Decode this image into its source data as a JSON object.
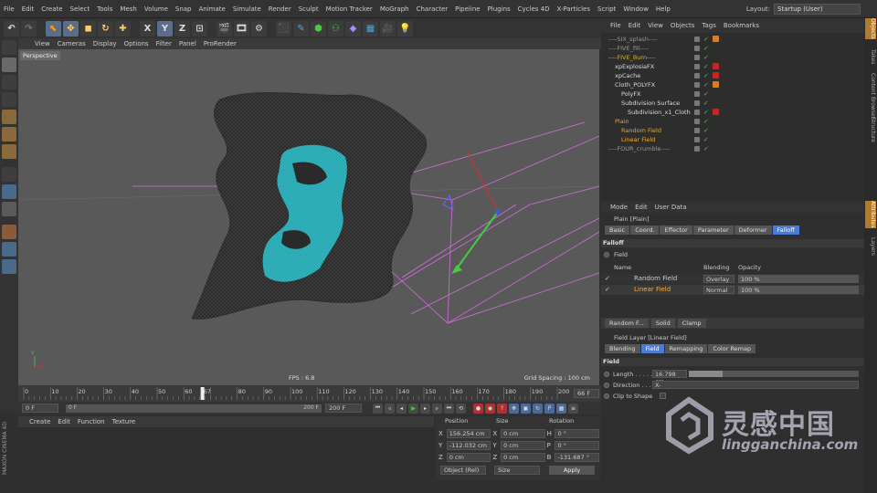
{
  "menubar": {
    "items": [
      "File",
      "Edit",
      "Create",
      "Select",
      "Tools",
      "Mesh",
      "Volume",
      "Snap",
      "Animate",
      "Simulate",
      "Render",
      "Sculpt",
      "Motion Tracker",
      "MoGraph",
      "Character",
      "Pipeline",
      "Plugins",
      "Cycles 4D",
      "X-Particles",
      "Script",
      "Window",
      "Help"
    ],
    "layout_label": "Layout:",
    "layout_value": "Startup (User)"
  },
  "toolbar": {
    "axis_x": "X",
    "axis_y": "Y",
    "axis_z": "Z"
  },
  "viewport": {
    "menu": [
      "View",
      "Cameras",
      "Display",
      "Options",
      "Filter",
      "Panel",
      "ProRender"
    ],
    "label": "Perspective",
    "fps": "FPS : 6.8",
    "grid_spacing": "Grid Spacing : 100 cm",
    "axis_y": "Y",
    "axis_z": "Z",
    "axis_x": "X"
  },
  "timeline": {
    "ticks": [
      "0",
      "10",
      "20",
      "30",
      "40",
      "50",
      "60",
      "67",
      "80",
      "90",
      "100",
      "110",
      "120",
      "130",
      "140",
      "150",
      "160",
      "170",
      "180",
      "190",
      "200"
    ],
    "current_frame": "66 F",
    "current": 67,
    "end": 200
  },
  "transport": {
    "start": "0 F",
    "range_start": "0 F",
    "range_end": "200 F",
    "end": "200 F"
  },
  "material": {
    "menu": [
      "Create",
      "Edit",
      "Function",
      "Texture"
    ],
    "brand": "MAXON CINEMA 4D"
  },
  "coord": {
    "headers": [
      "Position",
      "Size",
      "Rotation"
    ],
    "rows": [
      {
        "pl": "X",
        "p": "156.254 cm",
        "sl": "X",
        "s": "0 cm",
        "rl": "H",
        "r": "0 °"
      },
      {
        "pl": "Y",
        "p": "-112.032 cm",
        "sl": "Y",
        "s": "0 cm",
        "rl": "P",
        "r": "0 °"
      },
      {
        "pl": "Z",
        "p": "0 cm",
        "sl": "Z",
        "s": "0 cm",
        "rl": "B",
        "r": "-131.687 °"
      }
    ],
    "mode": "Object (Rel)",
    "size_mode": "Size",
    "apply": "Apply"
  },
  "objmgr": {
    "menu": [
      "File",
      "Edit",
      "View",
      "Objects",
      "Tags",
      "Bookmarks"
    ],
    "items": [
      {
        "name": "----SIX_splash----",
        "indent": 0,
        "color": "#999"
      },
      {
        "name": "----FIVE_fill----",
        "indent": 0,
        "color": "#999"
      },
      {
        "name": "----FIVE_Burn----",
        "indent": 0,
        "color": "#c9b24a"
      },
      {
        "name": "xpExplosiaFX",
        "indent": 1,
        "color": "#ddd"
      },
      {
        "name": "xpCache",
        "indent": 1,
        "color": "#ddd"
      },
      {
        "name": "Cloth_POLYFX",
        "indent": 1,
        "color": "#ddd"
      },
      {
        "name": "PolyFX",
        "indent": 2,
        "color": "#ddd"
      },
      {
        "name": "Subdivision Surface",
        "indent": 2,
        "color": "#ddd"
      },
      {
        "name": "Subdivision_x1_Cloth",
        "indent": 3,
        "color": "#ddd"
      },
      {
        "name": "Plain",
        "indent": 1,
        "color": "#e8a33a"
      },
      {
        "name": "Random Field",
        "indent": 2,
        "color": "#e8a33a"
      },
      {
        "name": "Linear Field",
        "indent": 2,
        "color": "#f0b040"
      },
      {
        "name": "----FOUR_crumble----",
        "indent": 0,
        "color": "#999"
      }
    ]
  },
  "attr": {
    "menu": [
      "Mode",
      "Edit",
      "User Data"
    ],
    "title": "Plain [Plain]",
    "tabs": [
      "Basic",
      "Coord.",
      "Effector",
      "Parameter",
      "Deformer",
      "Falloff"
    ],
    "active_tab": "Falloff",
    "falloff_head": "Falloff",
    "field_label": "Field",
    "col_name": "Name",
    "col_blend": "Blending",
    "col_opacity": "Opacity",
    "layers": [
      {
        "name": "Random Field",
        "blend": "Overlay",
        "opacity": "100 %"
      },
      {
        "name": "Linear Field",
        "blend": "Normal",
        "opacity": "100 %"
      }
    ],
    "layer_buttons": [
      "Random F...",
      "Solid",
      "Clamp"
    ],
    "layer_title": "Field Layer [Linear Field]",
    "layer_tabs": [
      "Blending",
      "Field",
      "Remapping",
      "Color Remap"
    ],
    "layer_active": "Field",
    "field_head": "Field",
    "length_label": "Length . . . . . .",
    "length_value": "16.798 cm",
    "length_fraction": 0.2,
    "direction_label": "Direction . . . .",
    "direction_value": "X-",
    "clip_label": "Clip to Shape"
  },
  "sidetabs": [
    "Objects",
    "Takes",
    "Content Browser",
    "Structure",
    "Attributes",
    "Layers"
  ],
  "watermark": {
    "cn": "灵感中国",
    "url": "lingganchina.com"
  }
}
